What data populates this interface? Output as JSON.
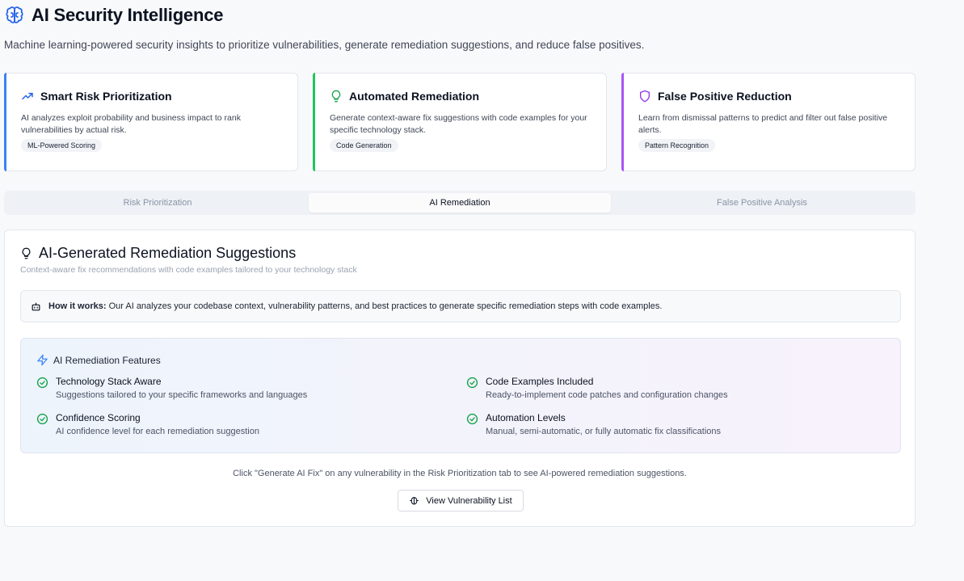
{
  "header": {
    "title": "AI Security Intelligence",
    "subtitle": "Machine learning-powered security insights to prioritize vulnerabilities, generate remediation suggestions, and reduce false positives.",
    "icon": "brain-icon"
  },
  "cards": [
    {
      "title": "Smart Risk Prioritization",
      "desc": "AI analyzes exploit probability and business impact to rank vulnerabilities by actual risk.",
      "badge": "ML-Powered Scoring",
      "accent": "#3b82f6",
      "icon": "trending-up-icon"
    },
    {
      "title": "Automated Remediation",
      "desc": "Generate context-aware fix suggestions with code examples for your specific technology stack.",
      "badge": "Code Generation",
      "accent": "#22c55e",
      "icon": "lightbulb-icon"
    },
    {
      "title": "False Positive Reduction",
      "desc": "Learn from dismissal patterns to predict and filter out false positive alerts.",
      "badge": "Pattern Recognition",
      "accent": "#a855f7",
      "icon": "shield-icon"
    }
  ],
  "tabs": [
    {
      "label": "Risk Prioritization",
      "active": false
    },
    {
      "label": "AI Remediation",
      "active": true
    },
    {
      "label": "False Positive Analysis",
      "active": false
    }
  ],
  "panel": {
    "title": "AI-Generated Remediation Suggestions",
    "subtitle": "Context-aware fix recommendations with code examples tailored to your technology stack",
    "info_label": "How it works:",
    "info_text": "Our AI analyzes your codebase context, vulnerability patterns, and best practices to generate specific remediation steps with code examples.",
    "features_title": "AI Remediation Features",
    "features": [
      {
        "title": "Technology Stack Aware",
        "desc": "Suggestions tailored to your specific frameworks and languages"
      },
      {
        "title": "Code Examples Included",
        "desc": "Ready-to-implement code patches and configuration changes"
      },
      {
        "title": "Confidence Scoring",
        "desc": "AI confidence level for each remediation suggestion"
      },
      {
        "title": "Automation Levels",
        "desc": "Manual, semi-automatic, or fully automatic fix classifications"
      }
    ],
    "hint": "Click \"Generate AI Fix\" on any vulnerability in the Risk Prioritization tab to see AI-powered remediation suggestions.",
    "button_label": "View Vulnerability List"
  },
  "colors": {
    "brand": "#2563eb",
    "check": "#16a34a",
    "feature_icon": "#3b82f6"
  }
}
